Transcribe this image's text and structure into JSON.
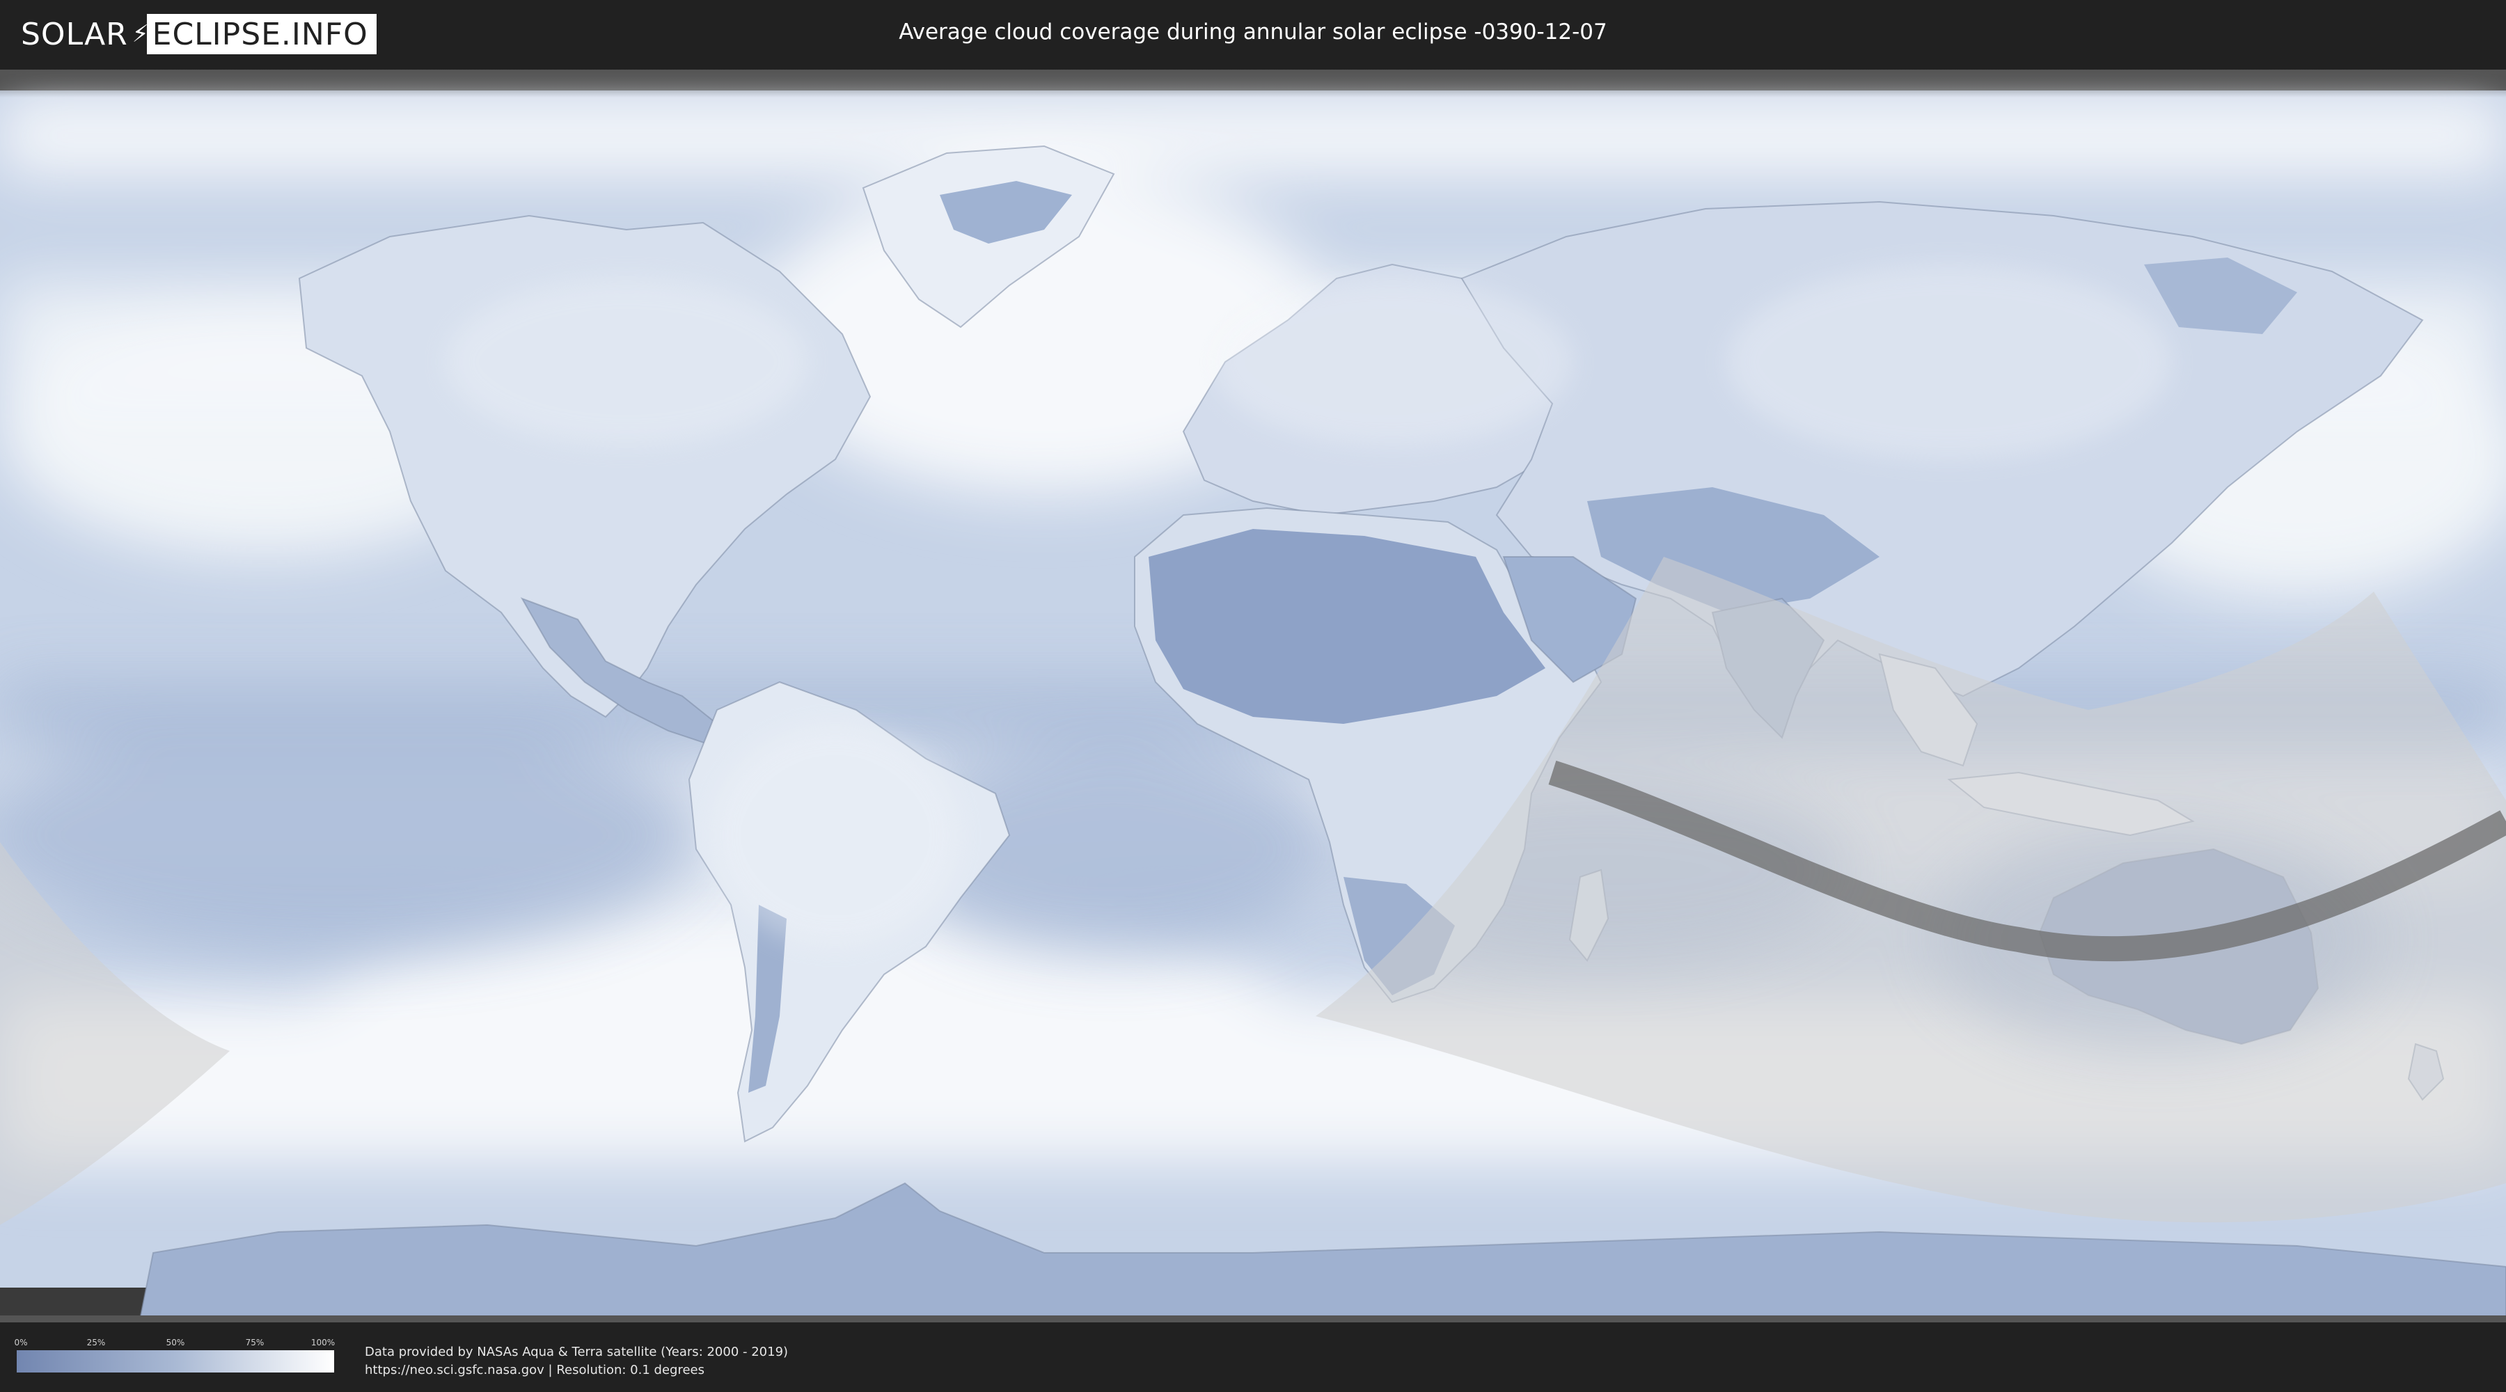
{
  "header": {
    "logo_left": "SOLAR",
    "logo_right": "ECLIPSE.INFO",
    "title": "Average cloud coverage during annular solar eclipse -0390-12-07"
  },
  "map": {
    "ocean_color": "#c4d1e6",
    "land_color": "#93a8cc",
    "cloud_color": "#f4f6fa",
    "penumbra_color": "#d0d0d0",
    "path_color": "#707070"
  },
  "legend": {
    "ticks": [
      "0%",
      "25%",
      "50%",
      "75%",
      "100%"
    ],
    "color_low": "#7286b0",
    "color_high": "#ffffff"
  },
  "footer": {
    "credit_line1": "Data provided by NASAs Aqua & Terra satellite (Years: 2000 - 2019)",
    "credit_line2": "https://neo.sci.gsfc.nasa.gov | Resolution: 0.1 degrees"
  }
}
